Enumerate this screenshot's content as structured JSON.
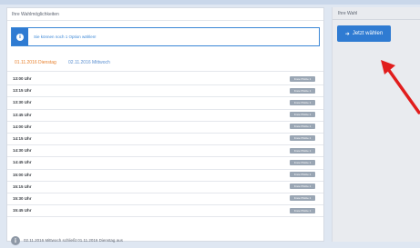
{
  "main": {
    "title": "Ihre Wahlmöglichkeiten",
    "info": "Sie können noch 1 Option wählen!",
    "tabs": [
      "01.11.2016 Dienstag",
      "02.11.2016 Mittwoch"
    ],
    "slots": [
      {
        "time": "13:00 Uhr",
        "button": "Freie Plätze 1"
      },
      {
        "time": "13:15 Uhr",
        "button": "Freie Plätze 1"
      },
      {
        "time": "13:30 Uhr",
        "button": "Freie Plätze 1"
      },
      {
        "time": "13:45 Uhr",
        "button": "Freie Plätze 1"
      },
      {
        "time": "14:00 Uhr",
        "button": "Freie Plätze 1"
      },
      {
        "time": "14:15 Uhr",
        "button": "Freie Plätze 1"
      },
      {
        "time": "14:30 Uhr",
        "button": "Freie Plätze 1"
      },
      {
        "time": "14:45 Uhr",
        "button": "Freie Plätze 1"
      },
      {
        "time": "15:00 Uhr",
        "button": "Freie Plätze 1"
      },
      {
        "time": "15:15 Uhr",
        "button": "Freie Plätze 1"
      },
      {
        "time": "15:30 Uhr",
        "button": "Freie Plätze 1"
      },
      {
        "time": "15:45 Uhr",
        "button": "Freie Plätze 1"
      }
    ],
    "footer": "02.11.2016 Mittwoch schließt 01.11.2016 Dienstag aus"
  },
  "side": {
    "title": "Ihre Wahl",
    "button": "Jetzt wählen",
    "button_icon": "arrow-right-icon"
  },
  "colors": {
    "accent": "#2f7bd2",
    "active_tab": "#e8822f",
    "inactive_tab": "#5a8fd0",
    "slot_button": "#9aa6b4",
    "annotation_arrow": "#e11d1d"
  }
}
